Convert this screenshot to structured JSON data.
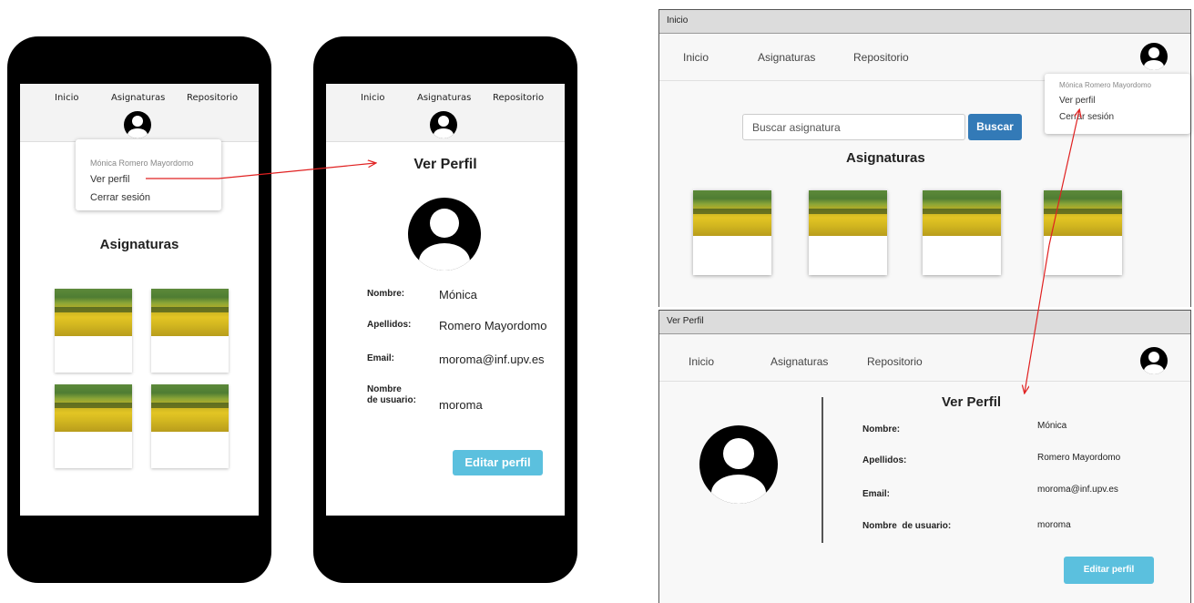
{
  "phone_left": {
    "nav": {
      "inicio": "Inicio",
      "asignaturas": "Asignaturas",
      "repositorio": "Repositorio"
    },
    "dropdown": {
      "user_name": "Mónica Romero Mayordomo",
      "ver_perfil": "Ver perfil",
      "cerrar_sesion": "Cerrar sesión"
    },
    "section_title": "Asignaturas",
    "cards_count": 4
  },
  "phone_right": {
    "nav": {
      "inicio": "Inicio",
      "asignaturas": "Asignaturas",
      "repositorio": "Repositorio"
    },
    "page_title": "Ver Perfil",
    "fields": [
      {
        "label": "Nombre:",
        "value": "Mónica"
      },
      {
        "label": "Apellidos:",
        "value": "Romero Mayordomo"
      },
      {
        "label": "Email:",
        "value": "moroma@inf.upv.es"
      },
      {
        "label_line1": "Nombre",
        "label_line2": "de usuario:",
        "value": "moroma"
      }
    ],
    "edit_button": "Editar perfil"
  },
  "desktop_inicio": {
    "window_title": "Inicio",
    "nav": {
      "inicio": "Inicio",
      "asignaturas": "Asignaturas",
      "repositorio": "Repositorio"
    },
    "dropdown": {
      "user_name": "Mónica Romero Mayordomo",
      "ver_perfil": "Ver perfil",
      "cerrar_sesion": "Cerrar sesión"
    },
    "search": {
      "placeholder": "Buscar asignatura",
      "button": "Buscar"
    },
    "section_title": "Asignaturas"
  },
  "desktop_perfil": {
    "window_title": "Ver Perfil",
    "nav": {
      "inicio": "Inicio",
      "asignaturas": "Asignaturas",
      "repositorio": "Repositorio"
    },
    "page_title": "Ver Perfil",
    "fields": [
      {
        "label": "Nombre:",
        "value": "Mónica"
      },
      {
        "label": "Apellidos:",
        "value": "Romero Mayordomo"
      },
      {
        "label": "Email:",
        "value": "moroma@inf.upv.es"
      },
      {
        "label": "Nombre  de usuario:",
        "value": "moroma"
      }
    ],
    "edit_button": "Editar perfil"
  },
  "colors": {
    "arrow": "#e02020",
    "button_blue": "#5bc0de",
    "search_button": "#337ab7",
    "phone": "#000000"
  }
}
